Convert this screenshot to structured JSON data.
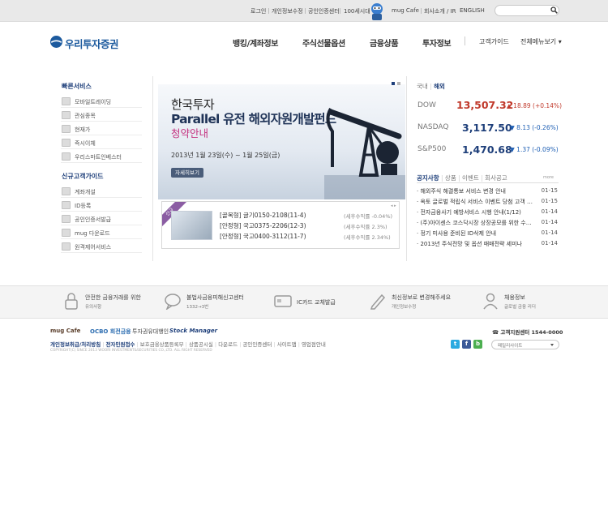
{
  "colors": {
    "brand_blue": "#1c5a9e",
    "navy": "#1e3f7a",
    "up_red": "#c0392b",
    "down_blue": "#1e5fb4",
    "accent_pink": "#c4317f"
  },
  "top_links": [
    "로그인",
    "개인정보수정",
    "공인인증센터",
    "100세시대",
    "mug Cafe",
    "회사소개 / IR",
    "ENGLISH"
  ],
  "logo": {
    "text": "우리투자증권"
  },
  "nav": {
    "items": [
      "뱅킹/계좌정보",
      "주식선물옵션",
      "금융상품",
      "투자정보"
    ],
    "guide": "고객가이드",
    "all_menu": "전체메뉴보기"
  },
  "quick": {
    "title": "빠른서비스",
    "items": [
      "모바일트레이딩",
      "관심종목",
      "현재가",
      "즉시이체",
      "우리스마트인베스터"
    ],
    "guide_title": "신규고객가이드",
    "guide_items": [
      "계좌개설",
      "ID등록",
      "공인인증서발급",
      "mug 다운로드",
      "원격제어서비스"
    ]
  },
  "banner": {
    "line1": "한국투자",
    "line2": "Parallel 유전 해외자원개발펀드",
    "line3": "청약안내",
    "date": "2013년 1월 23일(수) ~ 1월 25일(금)",
    "button": "자세히보기",
    "ribbon": "신규"
  },
  "funds": [
    {
      "name": "[골목형] 글기0150-2108(11-4)",
      "ret": "(세후수익률 -0.04%)"
    },
    {
      "name": "[안정형] 국고0375-2206(12-3)",
      "ret": "(세후수익률 2.3%)"
    },
    {
      "name": "[안정형] 국고0400-3112(11-7)",
      "ret": "(세후수익률 2.34%)"
    }
  ],
  "market": {
    "tabs": [
      "국내",
      "해외"
    ],
    "indices": [
      {
        "name": "DOW",
        "value": "13,507.32",
        "change": "18.89 (+0.14%)",
        "dir": "up"
      },
      {
        "name": "NASDAQ",
        "value": "3,117.50",
        "change": "8.13 (-0.26%)",
        "dir": "down"
      },
      {
        "name": "S&P500",
        "value": "1,470.68",
        "change": "1.37 (-0.09%)",
        "dir": "down"
      }
    ]
  },
  "notices": {
    "tabs": [
      "공지사항",
      "상품",
      "이벤트",
      "회사공고"
    ],
    "more": "more",
    "items": [
      {
        "title": "해외주식 해결통보 서비스 변경 안내",
        "date": "01-15"
      },
      {
        "title": "옥토 글로벌 적립식 서비스 이벤트 당첨 고객 안내",
        "date": "01-15"
      },
      {
        "title": "전자금융사기 예방서비스 시행 안내(1/12)",
        "date": "01-14"
      },
      {
        "title": "(주)아이센스 코스닥시장 상장공모를 위한 수요예측",
        "date": "01-14"
      },
      {
        "title": "정기 미사용 준비된 ID삭제 안내",
        "date": "01-14"
      },
      {
        "title": "2013년 주식전망 및 옵션 매매전략 세미나",
        "date": "01-14"
      }
    ]
  },
  "strip": [
    {
      "title": "안전한 금융거래를 위한",
      "sub": "유의사항",
      "icon": "lock-icon"
    },
    {
      "title": "불법사금융피해신고센터",
      "sub": "1332→3번",
      "icon": "speech-bubble-icon"
    },
    {
      "title": "IC카드 교체발급",
      "sub": "",
      "icon": "card-icon"
    },
    {
      "title": "최신정보로 변경해주세요",
      "sub": "개인정보수정",
      "icon": "pencil-icon"
    },
    {
      "title": "채용정보",
      "sub": "글로벌 금융 리더",
      "icon": "person-icon"
    }
  ],
  "footer": {
    "logos": [
      "mug Cafe",
      "OCBO 회전금융",
      "투자권유대행인",
      "Stock Manager"
    ],
    "links": [
      "개인정보취급/처리방침",
      "전자민원접수",
      "보호금융상품등록부",
      "상품공시실",
      "다운로드",
      "공인인증센터",
      "사이트맵",
      "영업점안내"
    ],
    "copyright": "COPYRIGHT(C) SINCE 2013 WOORI INVESTMENT&SECURITIES CO.,LTD. ALL RIGHT RESERVED",
    "phone": "고객지원센터 1544-0000",
    "family_site": "패밀리사이트"
  }
}
